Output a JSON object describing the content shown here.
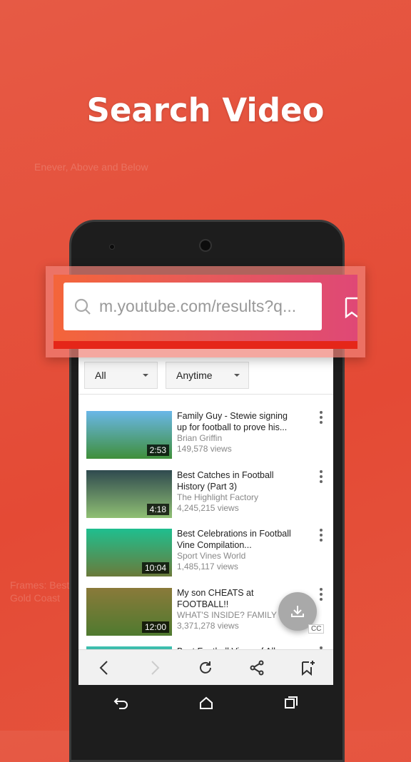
{
  "headline": "Search Video",
  "background_text": [
    "Enever, Above and Below",
    "Frames: Best",
    "Gold Coast"
  ],
  "search": {
    "url": "m.youtube.com/results?q..."
  },
  "filters": {
    "type": "All",
    "time": "Anytime"
  },
  "videos": [
    {
      "title": "Family Guy - Stewie signing up for football to prove his...",
      "channel": "Brian Griffin",
      "views": "149,578 views",
      "duration": "2:53",
      "thumb": [
        "#6ab7e8",
        "#3f8f3a"
      ]
    },
    {
      "title": "Best Catches in Football History (Part 3)",
      "channel": "The Highlight Factory",
      "views": "4,245,215 views",
      "duration": "4:18",
      "thumb": [
        "#2f4a4f",
        "#8fbf73"
      ]
    },
    {
      "title": "Best Celebrations in Football Vine Compilation...",
      "channel": "Sport Vines World",
      "views": "1,485,117 views",
      "duration": "10:04",
      "thumb": [
        "#1fbf8f",
        "#6a7a3a"
      ]
    },
    {
      "title": "My son CHEATS at FOOTBALL!!",
      "channel": "WHAT'S INSIDE? FAMILY",
      "views": "3,371,278 views",
      "duration": "12:00",
      "thumb": [
        "#8a7a3a",
        "#4f7a2f"
      ]
    },
    {
      "title": "Best Football Vines of All",
      "channel": "",
      "views": "",
      "duration": "",
      "thumb": [
        "#3ac0b0",
        "#c05a3a"
      ]
    }
  ],
  "cc_label": "CC",
  "colors": {
    "accent": "#e52619",
    "background": "#e5523c"
  }
}
